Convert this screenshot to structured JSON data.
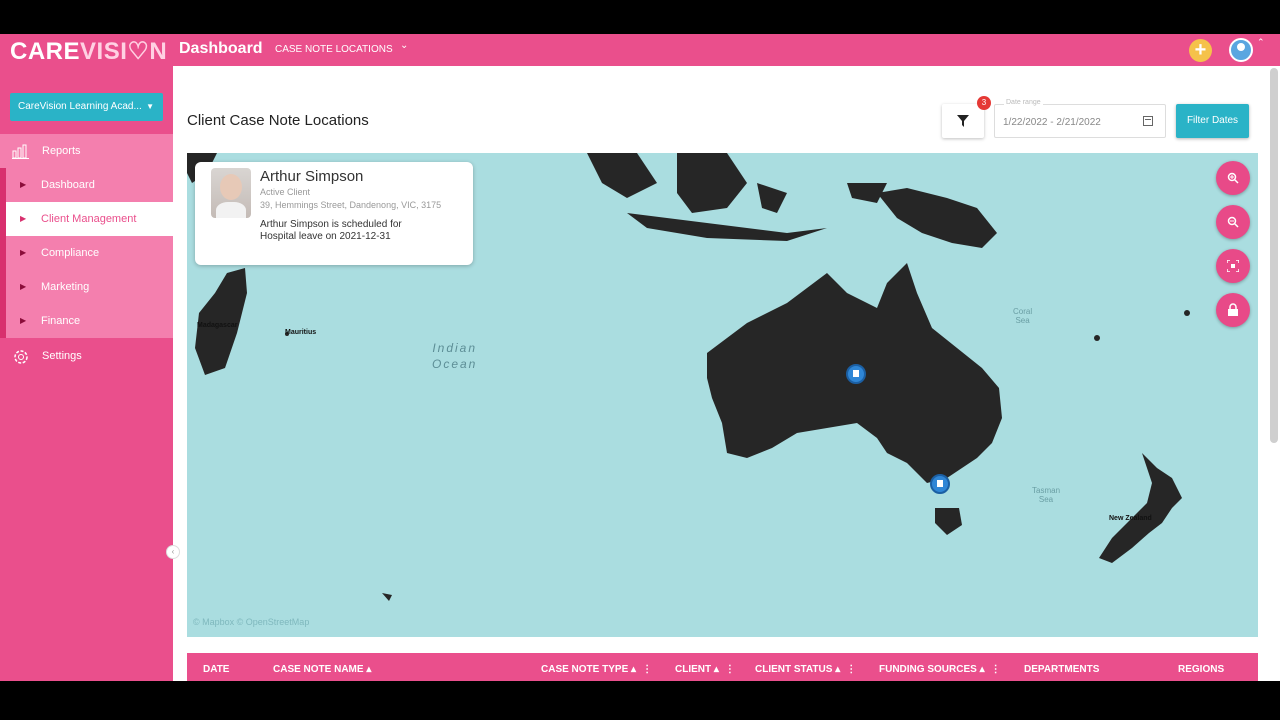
{
  "header": {
    "logo_left": "CARE",
    "logo_right": "VISI",
    "logo_end": "N",
    "title": "Dashboard",
    "subtitle": "CASE NOTE LOCATIONS",
    "add_symbol": "+"
  },
  "sidebar": {
    "org_select": "CareVision Learning Acad...",
    "reports_label": "Reports",
    "items": [
      {
        "label": "Dashboard"
      },
      {
        "label": "Client Management"
      },
      {
        "label": "Compliance"
      },
      {
        "label": "Marketing"
      },
      {
        "label": "Finance"
      }
    ],
    "settings_label": "Settings"
  },
  "page": {
    "title": "Client Case Note Locations",
    "filter_badge": "3",
    "date_label": "Date range",
    "date_range": "1/22/2022 - 2/21/2022",
    "filter_dates_label": "Filter Dates"
  },
  "map": {
    "ocean_label": "Indian\nOcean",
    "coral_sea": "Coral\nSea",
    "tasman_sea": "Tasman\nSea",
    "madagascar": "Madagascar",
    "mauritius": "Mauritius",
    "new_zealand": "New Zealand",
    "attribution": "© Mapbox © OpenStreetMap"
  },
  "client_card": {
    "name": "Arthur Simpson",
    "status": "Active Client",
    "address": "39, Hemmings Street, Dandenong, VIC, 3175",
    "note": "Arthur Simpson is scheduled for Hospital leave on 2021-12-31"
  },
  "table": {
    "columns": [
      "DATE",
      "CASE NOTE NAME",
      "CASE NOTE TYPE",
      "CLIENT",
      "CLIENT STATUS",
      "FUNDING SOURCES",
      "DEPARTMENTS",
      "REGIONS"
    ]
  },
  "colors": {
    "brand": "#ea4f8c",
    "accent": "#2ab3c7",
    "map_water": "#aadde0"
  }
}
